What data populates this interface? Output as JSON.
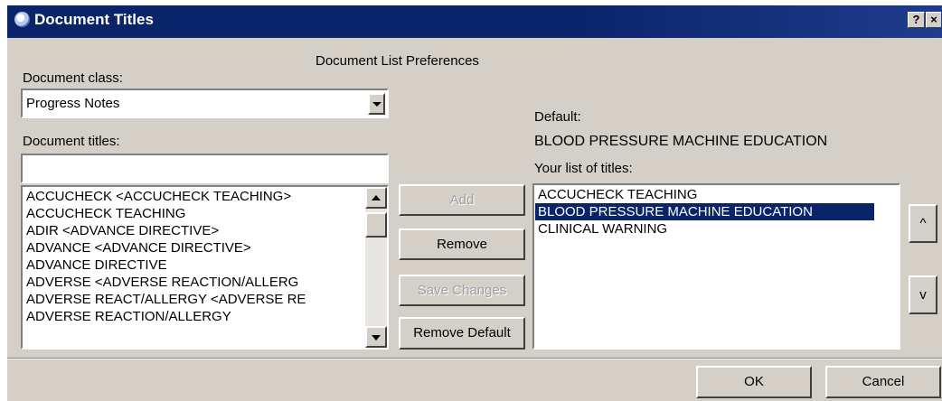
{
  "window": {
    "title": "Document Titles",
    "help_label": "?",
    "close_label": "×"
  },
  "header": "Document List Preferences",
  "document_class": {
    "label": "Document class:",
    "value": "Progress Notes"
  },
  "document_titles": {
    "label": "Document titles:",
    "search_value": "",
    "items": [
      "ACCUCHECK  <ACCUCHECK TEACHING>",
      "ACCUCHECK TEACHING",
      "ADIR <ADVANCE DIRECTIVE>",
      "ADVANCE  <ADVANCE DIRECTIVE>",
      "ADVANCE DIRECTIVE",
      "ADVERSE  <ADVERSE REACTION/ALLERG",
      "ADVERSE REACT/ALLERGY <ADVERSE RE",
      "ADVERSE REACTION/ALLERGY"
    ]
  },
  "buttons": {
    "add": "Add",
    "remove": "Remove",
    "save_changes": "Save Changes",
    "remove_default": "Remove Default",
    "move_up": "^",
    "move_down": "v",
    "ok": "OK",
    "cancel": "Cancel"
  },
  "default": {
    "label": "Default:",
    "value": "BLOOD PRESSURE MACHINE EDUCATION"
  },
  "your_titles": {
    "label": "Your list of titles:",
    "items": [
      "ACCUCHECK TEACHING",
      "BLOOD PRESSURE MACHINE EDUCATION",
      "CLINICAL WARNING"
    ],
    "selected_index": 1
  }
}
